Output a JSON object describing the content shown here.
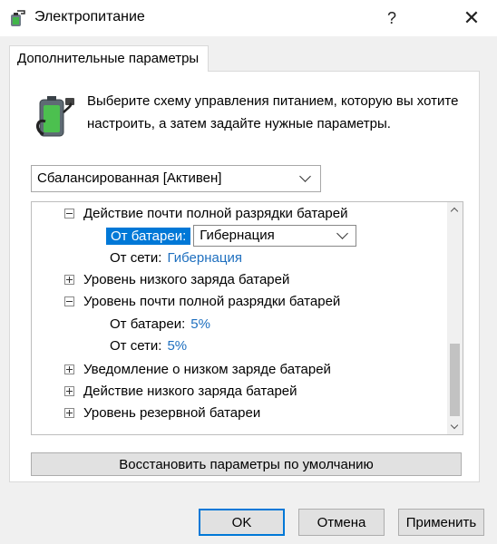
{
  "window": {
    "title": "Электропитание",
    "help": "?",
    "close": "✕"
  },
  "tab": {
    "label": "Дополнительные параметры"
  },
  "description": "Выберите схему управления питанием, которую вы хотите настроить, а затем задайте нужные параметры.",
  "scheme": {
    "selected": "Сбалансированная [Активен]"
  },
  "tree": {
    "critical_action": {
      "label": "Действие почти полной разрядки батарей",
      "on_battery_label": "От батареи:",
      "on_battery_value": "Гибернация",
      "plugged_label": "От сети:",
      "plugged_value": "Гибернация"
    },
    "low_level": {
      "label": "Уровень низкого заряда батарей"
    },
    "critical_level": {
      "label": "Уровень почти полной разрядки батарей",
      "on_battery_label": "От батареи:",
      "on_battery_value": "5%",
      "plugged_label": "От сети:",
      "plugged_value": "5%"
    },
    "low_notification": {
      "label": "Уведомление о низком заряде батарей"
    },
    "low_action": {
      "label": "Действие низкого заряда батарей"
    },
    "reserve_level": {
      "label": "Уровень резервной батареи"
    },
    "scroll": {
      "thumb_fraction": 0.31
    }
  },
  "buttons": {
    "restore": "Восстановить параметры по умолчанию",
    "ok": "OK",
    "cancel": "Отмена",
    "apply": "Применить"
  },
  "colors": {
    "accent": "#0078d7",
    "link_value": "#1e6fbf"
  }
}
